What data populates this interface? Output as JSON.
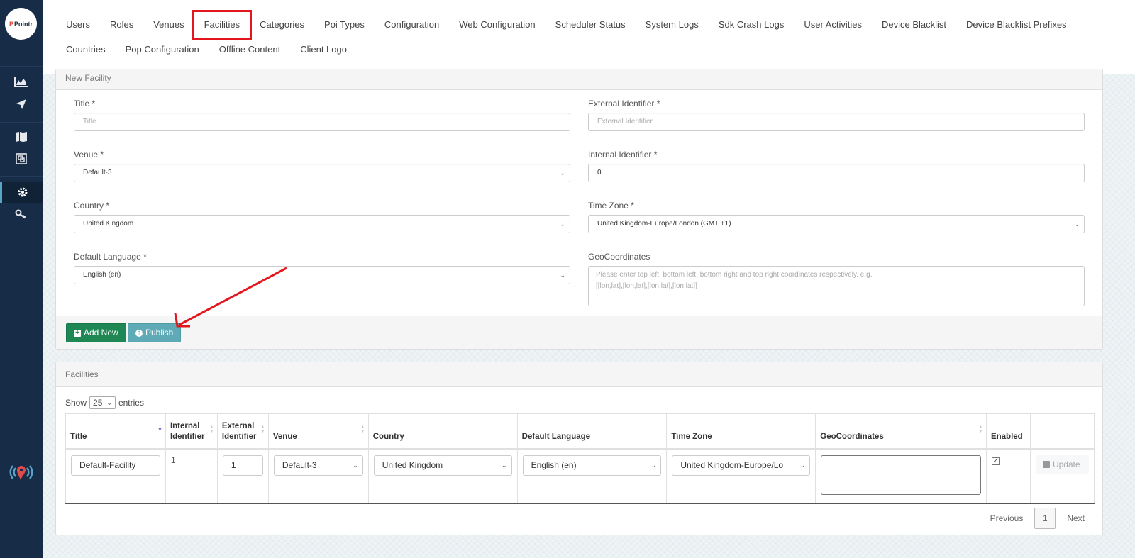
{
  "brand": {
    "logo_text": "Pointr",
    "logo_mark": "P"
  },
  "sidebar": {
    "icons": [
      {
        "name": "analytics-chart-icon"
      },
      {
        "name": "navigation-arrow-icon"
      },
      {
        "name": "map-icon"
      },
      {
        "name": "floor-plan-icon"
      },
      {
        "name": "settings-gear-icon",
        "active": true
      },
      {
        "name": "key-icon"
      }
    ],
    "footer_icon": "pointr-beacon-icon"
  },
  "nav": {
    "row1": [
      "Users",
      "Roles",
      "Venues",
      "Facilities",
      "Categories",
      "Poi Types",
      "Configuration",
      "Web Configuration",
      "Scheduler Status",
      "System Logs",
      "Sdk Crash Logs",
      "User Activities",
      "Device Blacklist",
      "Device Blacklist Prefixes"
    ],
    "row2": [
      "Countries",
      "Pop Configuration",
      "Offline Content",
      "Client Logo"
    ],
    "active": "Facilities"
  },
  "new_facility": {
    "heading": "New Facility",
    "title": {
      "label": "Title *",
      "placeholder": "Title",
      "value": ""
    },
    "external_identifier": {
      "label": "External Identifier *",
      "placeholder": "External Identifier",
      "value": ""
    },
    "venue": {
      "label": "Venue *",
      "value": "Default-3"
    },
    "internal_identifier": {
      "label": "Internal Identifier *",
      "value": "0"
    },
    "country": {
      "label": "Country *",
      "value": "United Kingdom"
    },
    "time_zone": {
      "label": "Time Zone *",
      "value": "United Kingdom-Europe/London (GMT +1)"
    },
    "default_language": {
      "label": "Default Language *",
      "value": "English (en)"
    },
    "geo_coordinates": {
      "label": "GeoCoordinates",
      "placeholder_line1": "Please enter top left, bottom left, bottom right and top right coordinates respectively. e.g.",
      "placeholder_line2": "[[lon,lat],[lon,lat],[lon,lat],[lon,lat]]"
    },
    "buttons": {
      "add_new": "Add New",
      "publish": "Publish"
    }
  },
  "facilities": {
    "heading": "Facilities",
    "show_label": "Show",
    "page_size": "25",
    "entries_label": "entries",
    "columns": [
      {
        "line1": "Title",
        "line2": "",
        "sort": "desc"
      },
      {
        "line1": "Internal",
        "line2": "Identifier",
        "sort": "both"
      },
      {
        "line1": "External",
        "line2": "Identifier",
        "sort": "both"
      },
      {
        "line1": "Venue",
        "line2": "",
        "sort": "both"
      },
      {
        "line1": "Country",
        "line2": "",
        "sort": ""
      },
      {
        "line1": "Default Language",
        "line2": "",
        "sort": ""
      },
      {
        "line1": "Time Zone",
        "line2": "",
        "sort": ""
      },
      {
        "line1": "GeoCoordinates",
        "line2": "",
        "sort": "both"
      },
      {
        "line1": "Enabled",
        "line2": "",
        "sort": ""
      },
      {
        "line1": "",
        "line2": "",
        "sort": ""
      }
    ],
    "rows": [
      {
        "title": "Default-Facility",
        "internal_identifier": "1",
        "external_identifier": "1",
        "venue": "Default-3",
        "country": "United Kingdom",
        "default_language": "English (en)",
        "time_zone": "United Kingdom-Europe/Lo",
        "geo_coordinates": "",
        "enabled": true,
        "update_label": "Update"
      }
    ],
    "pagination": {
      "previous": "Previous",
      "current": "1",
      "next": "Next"
    }
  },
  "annotations": {
    "arrow_color": "#e3161e",
    "highlight_color": "#e3161e"
  }
}
